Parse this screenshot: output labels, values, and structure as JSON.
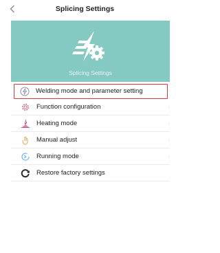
{
  "nav": {
    "title": "Splicing Settings"
  },
  "banner": {
    "subtitle": "Splicing Settings",
    "color": "#84c9c2"
  },
  "menu": {
    "items": [
      {
        "label": "Welding mode and parameter setting",
        "icon": "lightning-circle-icon",
        "selected": true
      },
      {
        "label": "Function configuration",
        "icon": "gear-icon",
        "selected": false
      },
      {
        "label": "Heating mode",
        "icon": "heating-icon",
        "selected": false
      },
      {
        "label": "Manual adjust",
        "icon": "hand-icon",
        "selected": false
      },
      {
        "label": "Running mode",
        "icon": "running-icon",
        "selected": false
      },
      {
        "label": "Restore factory settings",
        "icon": "restore-icon",
        "selected": false
      }
    ]
  },
  "colors": {
    "selection_border": "#d9373f"
  }
}
